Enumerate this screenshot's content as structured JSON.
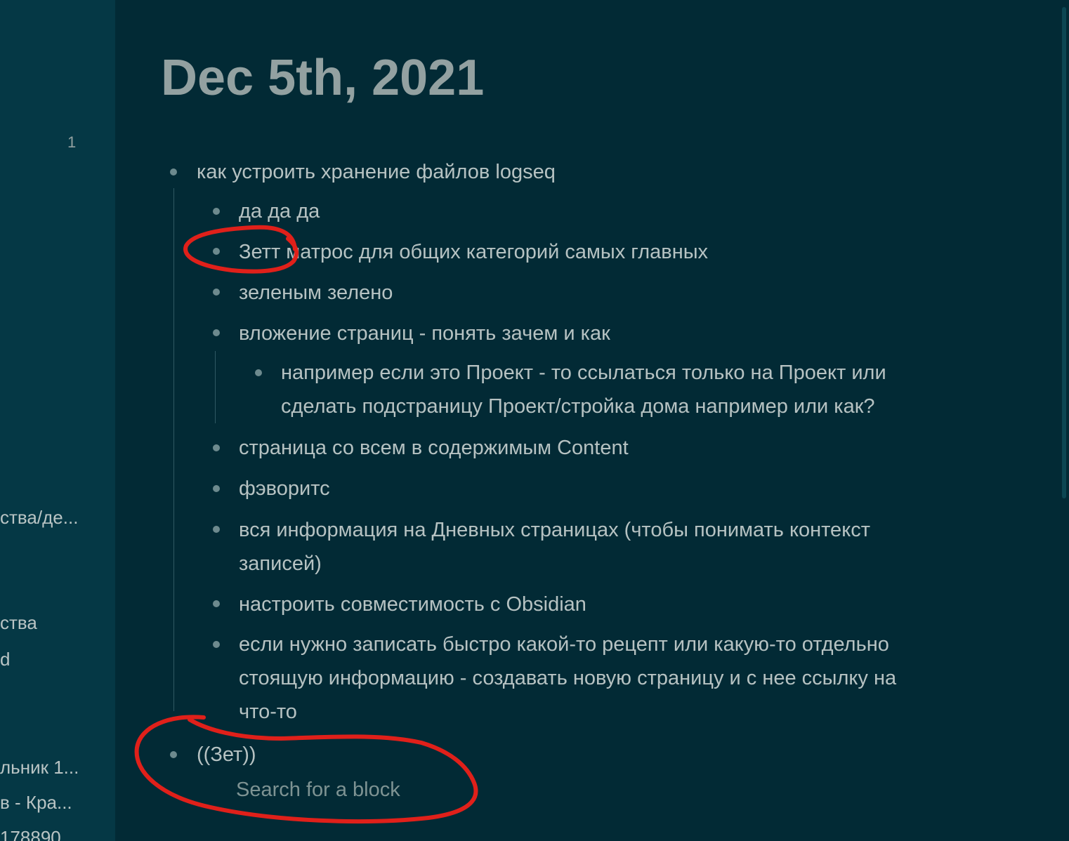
{
  "sidebar": {
    "badge": "1",
    "items": [
      {
        "label": "ства/де..."
      },
      {
        "label": "ства"
      },
      {
        "label": "d"
      },
      {
        "label": "льник 1..."
      },
      {
        "label": "в - Кра..."
      },
      {
        "label": "178890"
      }
    ]
  },
  "page": {
    "title": "Dec 5th, 2021"
  },
  "blocks": {
    "b0": "как устроить хранение файлов logseq",
    "b1": "да да да",
    "b2": "Зетт матрос для общих категорий самых главных",
    "b3": "зеленым зелено",
    "b4": "вложение страниц - понять зачем и как",
    "b5_line1": "например если это Проект - то ссылаться только на Проект или",
    "b5_line2": "сделать подстраницу Проект/стройка дома например или как?",
    "b6": "страница со всем в содержимым Content",
    "b7": "фэворитс",
    "b8_line1": "вся информация на Дневных страницах (чтобы понимать контекст",
    "b8_line2": "записей)",
    "b9": "настроить совместимость с Obsidian",
    "b10_line1": "если нужно записать быстро какой-то рецепт или какую-то отдельно",
    "b10_line2": "стоящую информацию - создавать новую страницу и с нее ссылку на",
    "b10_line3": "что-то",
    "b11": "((Зет))"
  },
  "editor": {
    "search_placeholder": "Search for a block"
  },
  "colors": {
    "background": "#022a35",
    "sidebar": "#053845",
    "text": "#b6c2c2",
    "title": "#93a1a1",
    "annotation": "#e0201a"
  }
}
